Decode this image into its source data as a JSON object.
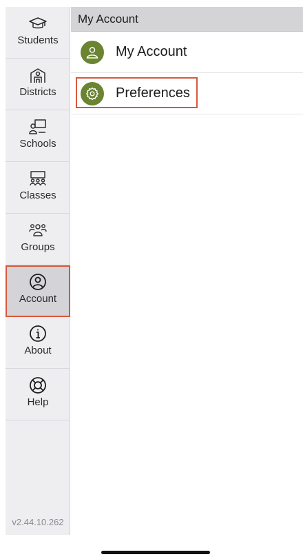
{
  "sidebar": {
    "items": [
      {
        "label": "Students",
        "icon": "graduation-cap-icon"
      },
      {
        "label": "Districts",
        "icon": "district-building-icon"
      },
      {
        "label": "Schools",
        "icon": "teacher-board-icon"
      },
      {
        "label": "Classes",
        "icon": "classroom-icon"
      },
      {
        "label": "Groups",
        "icon": "group-people-icon"
      },
      {
        "label": "Account",
        "icon": "account-icon"
      },
      {
        "label": "About",
        "icon": "info-icon"
      },
      {
        "label": "Help",
        "icon": "lifebuoy-icon"
      }
    ],
    "active": "Account",
    "version": "v2.44.10.262"
  },
  "main": {
    "title": "My Account",
    "rows": [
      {
        "label": "My Account",
        "icon": "user-icon"
      },
      {
        "label": "Preferences",
        "icon": "gear-icon"
      }
    ]
  },
  "colors": {
    "accent_green": "#6a8431",
    "highlight_red": "#d9573b",
    "sidebar_bg": "#eeeef1",
    "header_bg": "#d4d4d7"
  }
}
